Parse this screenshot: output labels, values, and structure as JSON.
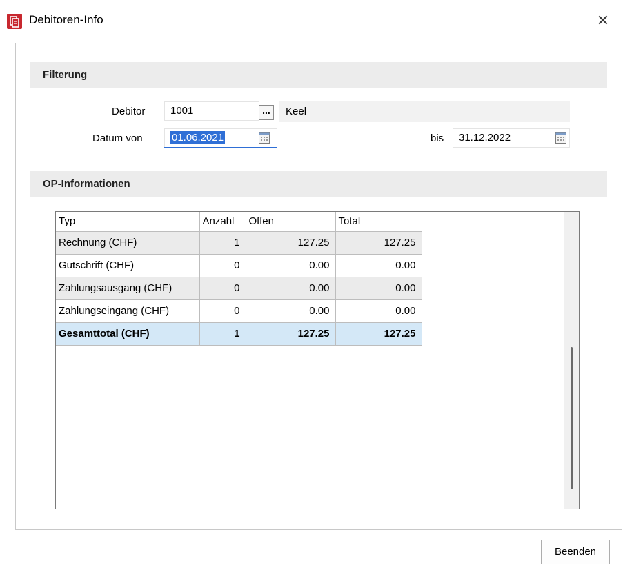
{
  "window": {
    "title": "Debitoren-Info",
    "close_glyph": "✕"
  },
  "filter": {
    "header": "Filterung",
    "debitor_label": "Debitor",
    "debitor_value": "1001",
    "lookup_label": "...",
    "debitor_name": "Keel",
    "date_from_label": "Datum von",
    "date_from_value": "01.06.2021",
    "date_to_label": "bis",
    "date_to_value": "31.12.2022"
  },
  "op": {
    "header": "OP-Informationen",
    "columns": [
      "Typ",
      "Anzahl",
      "Offen",
      "Total"
    ],
    "rows": [
      {
        "typ": "Rechnung (CHF)",
        "anzahl": "1",
        "offen": "127.25",
        "total": "127.25"
      },
      {
        "typ": "Gutschrift (CHF)",
        "anzahl": "0",
        "offen": "0.00",
        "total": "0.00"
      },
      {
        "typ": "Zahlungsausgang (CHF)",
        "anzahl": "0",
        "offen": "0.00",
        "total": "0.00"
      },
      {
        "typ": "Zahlungseingang (CHF)",
        "anzahl": "0",
        "offen": "0.00",
        "total": "0.00"
      },
      {
        "typ": "Gesamttotal (CHF)",
        "anzahl": "1",
        "offen": "127.25",
        "total": "127.25"
      }
    ]
  },
  "footer": {
    "close_button": "Beenden"
  },
  "colors": {
    "selection": "#2f6fd6",
    "total_row": "#d4e8f7",
    "app_icon": "#c8282f"
  },
  "icons": [
    "app-icon",
    "close-icon",
    "calendar-icon"
  ]
}
